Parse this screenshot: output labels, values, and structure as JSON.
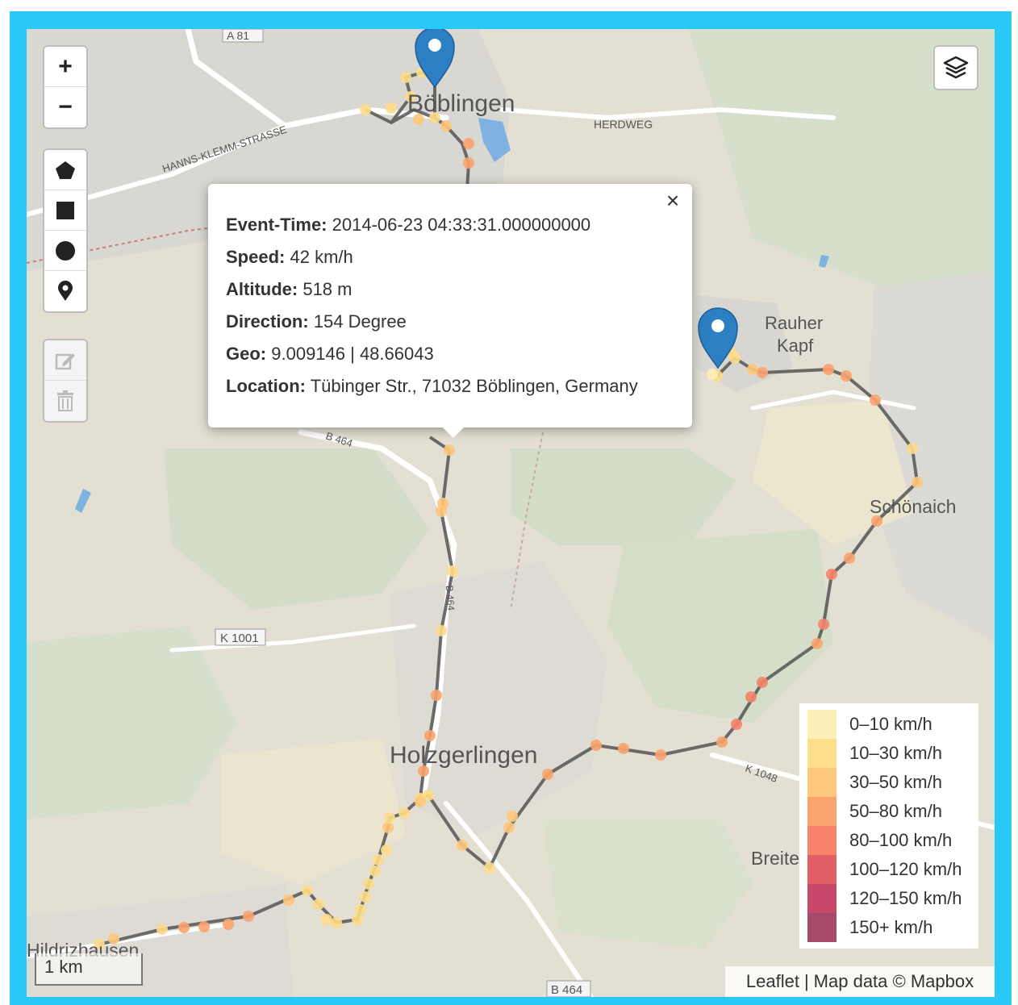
{
  "controls": {
    "zoom_in": "+",
    "zoom_out": "−",
    "draw_tools": [
      "draw-polygon",
      "draw-rectangle",
      "draw-circle",
      "draw-marker"
    ],
    "edit_tools": [
      "edit-layers",
      "delete-layers"
    ]
  },
  "map_labels": {
    "towns": [
      "Böblingen",
      "Holzgerlingen",
      "Schönaich",
      "Hildrizhausen",
      "Breite"
    ],
    "areas": [
      "Rauher",
      "Kapf"
    ],
    "streets": [
      "HANNS-KLEMM-STRASSE",
      "HERDWEG",
      "B 464",
      "K 1048",
      "A 81",
      "K 1001",
      "B 464",
      "B 464"
    ]
  },
  "popup": {
    "event_time_label": "Event-Time:",
    "event_time_value": "2014-06-23 04:33:31.000000000",
    "speed_label": "Speed:",
    "speed_value": "42 km/h",
    "altitude_label": "Altitude:",
    "altitude_value": "518 m",
    "direction_label": "Direction:",
    "direction_value": "154 Degree",
    "geo_label": "Geo:",
    "geo_value": "9.009146 | 48.66043",
    "location_label": "Location:",
    "location_value": "Tübinger Str., 71032 Böblingen, Germany",
    "close": "×"
  },
  "legend": [
    {
      "label": "0–10 km/h",
      "color": "#fdefb8"
    },
    {
      "label": "10–30 km/h",
      "color": "#fddc8a"
    },
    {
      "label": "30–50 km/h",
      "color": "#fdc77c"
    },
    {
      "label": "50–80 km/h",
      "color": "#fba36e"
    },
    {
      "label": "80–100 km/h",
      "color": "#f6836a"
    },
    {
      "label": "100–120 km/h",
      "color": "#e35f68"
    },
    {
      "label": "120–150 km/h",
      "color": "#c9486a"
    },
    {
      "label": "150+ km/h",
      "color": "#a54a6a"
    }
  ],
  "scale": "1 km",
  "attribution": {
    "leaflet": "Leaflet",
    "separator": "|",
    "mapdata": "Map data © Mapbox"
  },
  "colors": {
    "frame": "#29c8f7",
    "route": "#555555",
    "marker": "#2d7fc4"
  }
}
